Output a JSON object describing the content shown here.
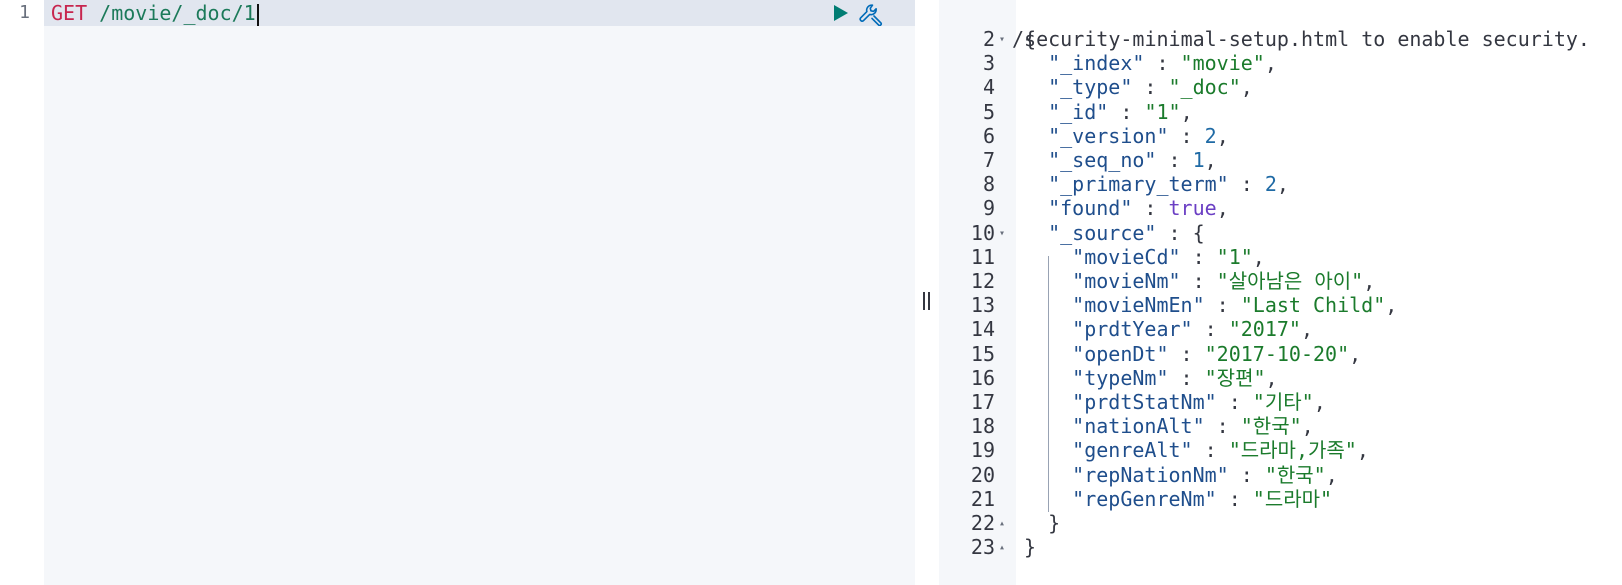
{
  "request": {
    "line_number": "1",
    "method": "GET",
    "path": "/movie/_doc/1"
  },
  "toolbar": {
    "play_icon": "play-icon",
    "wrench_icon": "wrench-icon",
    "play_color": "#017d73",
    "wrench_color": "#006bb8"
  },
  "resizer": {
    "icon": "drag-handle-icon"
  },
  "response": {
    "header_line": "/security-minimal-setup.html to enable security.",
    "lines": [
      {
        "no": "2",
        "fold": "▾",
        "tokens": [
          [
            "p",
            "{"
          ]
        ]
      },
      {
        "no": "3",
        "fold": "",
        "tokens": [
          [
            "p",
            "  "
          ],
          [
            "k",
            "\"_index\""
          ],
          [
            "p",
            " : "
          ],
          [
            "s",
            "\"movie\""
          ],
          [
            "p",
            ","
          ]
        ]
      },
      {
        "no": "4",
        "fold": "",
        "tokens": [
          [
            "p",
            "  "
          ],
          [
            "k",
            "\"_type\""
          ],
          [
            "p",
            " : "
          ],
          [
            "s",
            "\"_doc\""
          ],
          [
            "p",
            ","
          ]
        ]
      },
      {
        "no": "5",
        "fold": "",
        "tokens": [
          [
            "p",
            "  "
          ],
          [
            "k",
            "\"_id\""
          ],
          [
            "p",
            " : "
          ],
          [
            "s",
            "\"1\""
          ],
          [
            "p",
            ","
          ]
        ]
      },
      {
        "no": "6",
        "fold": "",
        "tokens": [
          [
            "p",
            "  "
          ],
          [
            "k",
            "\"_version\""
          ],
          [
            "p",
            " : "
          ],
          [
            "n",
            "2"
          ],
          [
            "p",
            ","
          ]
        ]
      },
      {
        "no": "7",
        "fold": "",
        "tokens": [
          [
            "p",
            "  "
          ],
          [
            "k",
            "\"_seq_no\""
          ],
          [
            "p",
            " : "
          ],
          [
            "n",
            "1"
          ],
          [
            "p",
            ","
          ]
        ]
      },
      {
        "no": "8",
        "fold": "",
        "tokens": [
          [
            "p",
            "  "
          ],
          [
            "k",
            "\"_primary_term\""
          ],
          [
            "p",
            " : "
          ],
          [
            "n",
            "2"
          ],
          [
            "p",
            ","
          ]
        ]
      },
      {
        "no": "9",
        "fold": "",
        "tokens": [
          [
            "p",
            "  "
          ],
          [
            "k",
            "\"found\""
          ],
          [
            "p",
            " : "
          ],
          [
            "b",
            "true"
          ],
          [
            "p",
            ","
          ]
        ]
      },
      {
        "no": "10",
        "fold": "▾",
        "tokens": [
          [
            "p",
            "  "
          ],
          [
            "k",
            "\"_source\""
          ],
          [
            "p",
            " : {"
          ]
        ]
      },
      {
        "no": "11",
        "fold": "",
        "tokens": [
          [
            "p",
            "    "
          ],
          [
            "k",
            "\"movieCd\""
          ],
          [
            "p",
            " : "
          ],
          [
            "s",
            "\"1\""
          ],
          [
            "p",
            ","
          ]
        ]
      },
      {
        "no": "12",
        "fold": "",
        "tokens": [
          [
            "p",
            "    "
          ],
          [
            "k",
            "\"movieNm\""
          ],
          [
            "p",
            " : "
          ],
          [
            "s",
            "\"살아남은 아이\""
          ],
          [
            "p",
            ","
          ]
        ]
      },
      {
        "no": "13",
        "fold": "",
        "tokens": [
          [
            "p",
            "    "
          ],
          [
            "k",
            "\"movieNmEn\""
          ],
          [
            "p",
            " : "
          ],
          [
            "s",
            "\"Last Child\""
          ],
          [
            "p",
            ","
          ]
        ]
      },
      {
        "no": "14",
        "fold": "",
        "tokens": [
          [
            "p",
            "    "
          ],
          [
            "k",
            "\"prdtYear\""
          ],
          [
            "p",
            " : "
          ],
          [
            "s",
            "\"2017\""
          ],
          [
            "p",
            ","
          ]
        ]
      },
      {
        "no": "15",
        "fold": "",
        "tokens": [
          [
            "p",
            "    "
          ],
          [
            "k",
            "\"openDt\""
          ],
          [
            "p",
            " : "
          ],
          [
            "s",
            "\"2017-10-20\""
          ],
          [
            "p",
            ","
          ]
        ]
      },
      {
        "no": "16",
        "fold": "",
        "tokens": [
          [
            "p",
            "    "
          ],
          [
            "k",
            "\"typeNm\""
          ],
          [
            "p",
            " : "
          ],
          [
            "s",
            "\"장편\""
          ],
          [
            "p",
            ","
          ]
        ]
      },
      {
        "no": "17",
        "fold": "",
        "tokens": [
          [
            "p",
            "    "
          ],
          [
            "k",
            "\"prdtStatNm\""
          ],
          [
            "p",
            " : "
          ],
          [
            "s",
            "\"기타\""
          ],
          [
            "p",
            ","
          ]
        ]
      },
      {
        "no": "18",
        "fold": "",
        "tokens": [
          [
            "p",
            "    "
          ],
          [
            "k",
            "\"nationAlt\""
          ],
          [
            "p",
            " : "
          ],
          [
            "s",
            "\"한국\""
          ],
          [
            "p",
            ","
          ]
        ]
      },
      {
        "no": "19",
        "fold": "",
        "tokens": [
          [
            "p",
            "    "
          ],
          [
            "k",
            "\"genreAlt\""
          ],
          [
            "p",
            " : "
          ],
          [
            "s",
            "\"드라마,가족\""
          ],
          [
            "p",
            ","
          ]
        ]
      },
      {
        "no": "20",
        "fold": "",
        "tokens": [
          [
            "p",
            "    "
          ],
          [
            "k",
            "\"repNationNm\""
          ],
          [
            "p",
            " : "
          ],
          [
            "s",
            "\"한국\""
          ],
          [
            "p",
            ","
          ]
        ]
      },
      {
        "no": "21",
        "fold": "",
        "tokens": [
          [
            "p",
            "    "
          ],
          [
            "k",
            "\"repGenreNm\""
          ],
          [
            "p",
            " : "
          ],
          [
            "s",
            "\"드라마\""
          ]
        ]
      },
      {
        "no": "22",
        "fold": "▴",
        "tokens": [
          [
            "p",
            "  }"
          ]
        ]
      },
      {
        "no": "23",
        "fold": "▴",
        "tokens": [
          [
            "p",
            "}"
          ]
        ]
      }
    ]
  }
}
